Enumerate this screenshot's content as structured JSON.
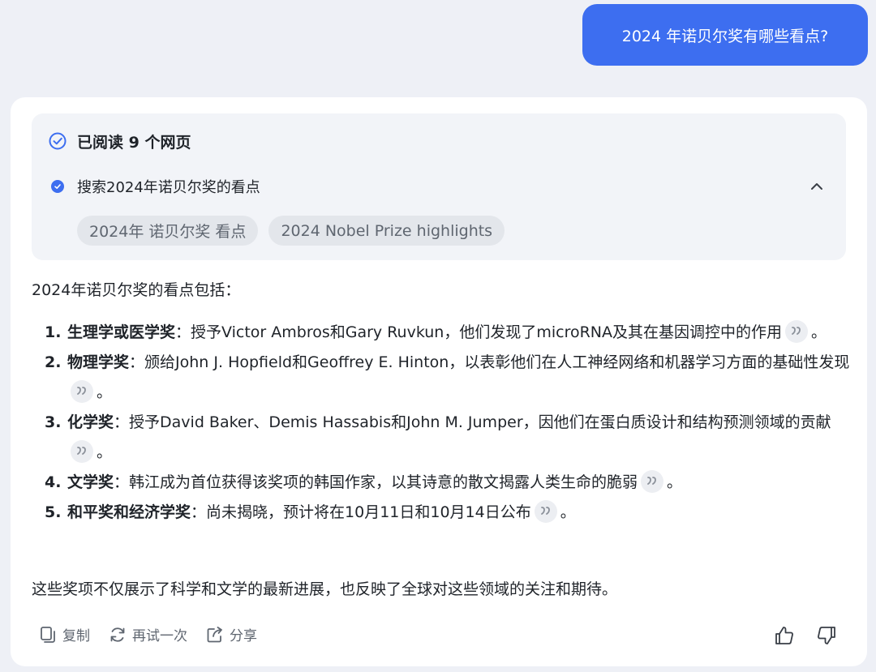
{
  "user_message": "2024 年诺贝尔奖有哪些看点?",
  "search_panel": {
    "read_status": "已阅读 9 个网页",
    "query_label": "搜索2024年诺贝尔奖的看点",
    "chips": [
      "2024年 诺贝尔奖 看点",
      "2024 Nobel Prize highlights"
    ]
  },
  "answer": {
    "intro": "2024年诺贝尔奖的看点包括：",
    "items": [
      {
        "num": "1.",
        "title": "生理学或医学奖",
        "sep": "：",
        "body": "授予Victor Ambros和Gary Ruvkun，他们发现了microRNA及其在基因调控中的作用",
        "end": "。"
      },
      {
        "num": "2.",
        "title": "物理学奖",
        "sep": "：",
        "body": "颁给John J. Hopfield和Geoffrey E. Hinton，以表彰他们在人工神经网络和机器学习方面的基础性发现",
        "end": "。"
      },
      {
        "num": "3.",
        "title": "化学奖",
        "sep": "：",
        "body": "授予David Baker、Demis Hassabis和John M. Jumper，因他们在蛋白质设计和结构预测领域的贡献",
        "end": "。"
      },
      {
        "num": "4.",
        "title": "文学奖",
        "sep": "：",
        "body": "韩江成为首位获得该奖项的韩国作家，以其诗意的散文揭露人类生命的脆弱",
        "end": "。"
      },
      {
        "num": "5.",
        "title": "和平奖和经济学奖",
        "sep": "：",
        "body": "尚未揭晓，预计将在10月11日和10月14日公布",
        "end": "。"
      }
    ],
    "outro": "这些奖项不仅展示了科学和文学的最新进展，也反映了全球对这些领域的关注和期待。"
  },
  "actions": {
    "copy": "复制",
    "retry": "再试一次",
    "share": "分享"
  },
  "colors": {
    "accent": "#3d6ef0",
    "page_bg": "#eef0f6",
    "card_bg": "#ffffff",
    "panel_bg": "#f2f4f8"
  }
}
